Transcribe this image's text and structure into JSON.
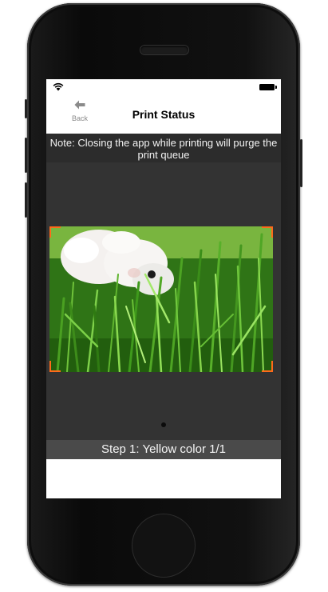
{
  "status_bar": {
    "wifi_icon": "wifi-icon",
    "battery_icon": "battery-icon"
  },
  "navbar": {
    "back_label": "Back",
    "back_icon": "back-arrow-icon",
    "title": "Print Status"
  },
  "notice": {
    "text": "Note: Closing the app while printing will purge the print queue"
  },
  "preview": {
    "image_subject": "white puppy in green grass",
    "frame_accent_color": "#ff6a1a"
  },
  "pager": {
    "pages": 1,
    "current": 1
  },
  "progress": {
    "step_text": "Step 1: Yellow color 1/1"
  },
  "colors": {
    "content_bg": "#333333",
    "note_bg": "#2c2c2c",
    "step_bg": "#4a4a4a"
  }
}
